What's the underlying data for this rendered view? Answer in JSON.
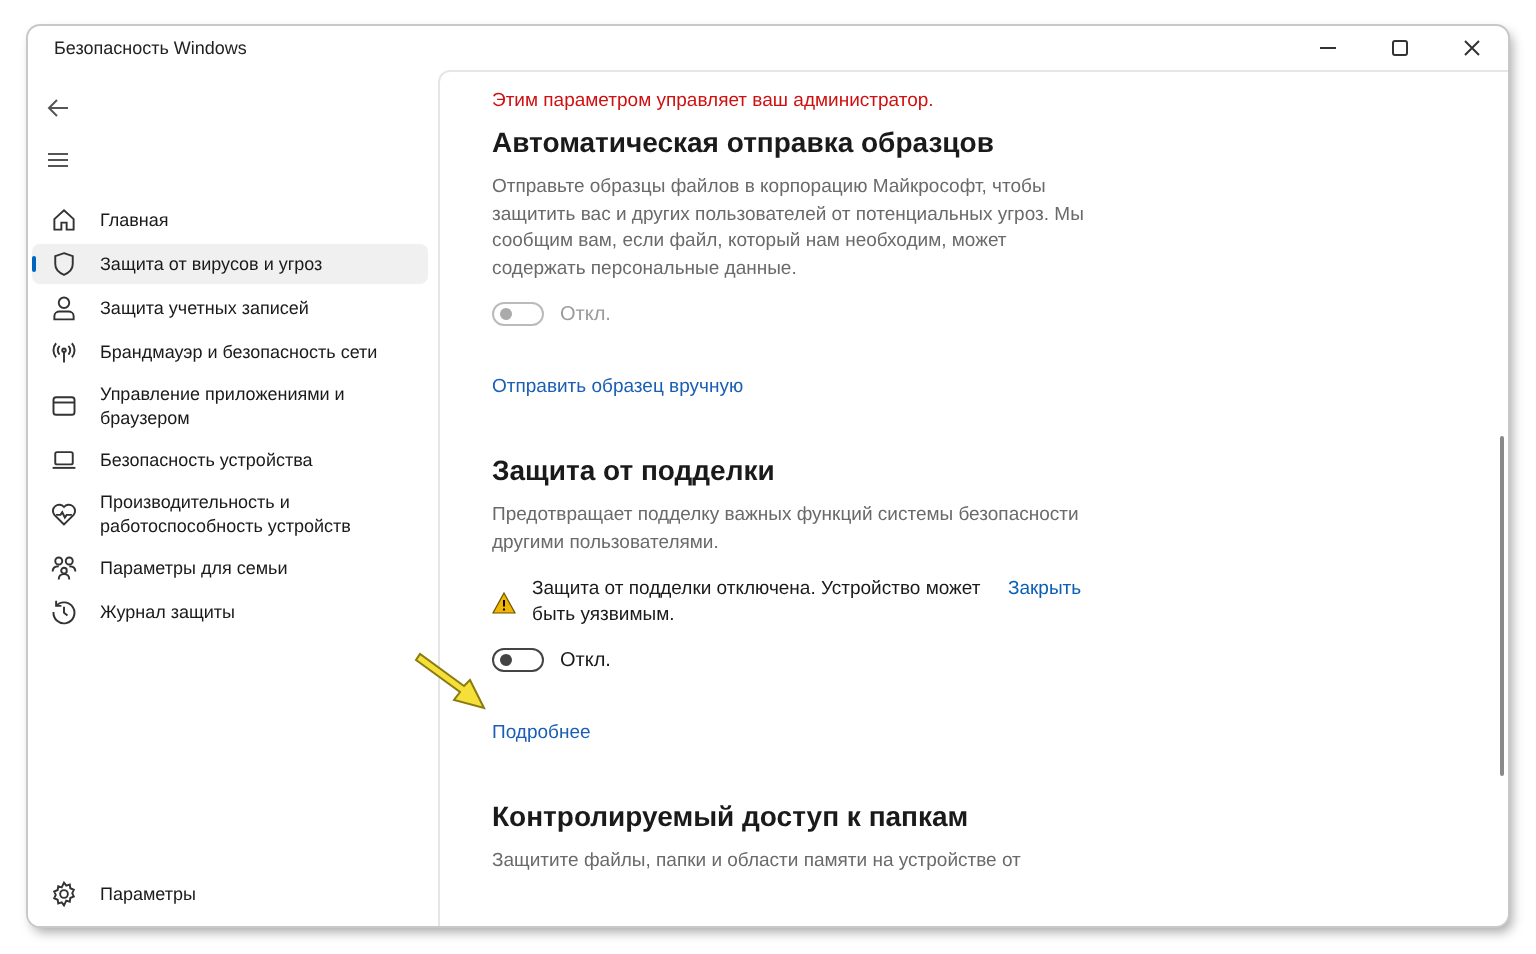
{
  "window": {
    "title": "Безопасность Windows"
  },
  "sidebar": {
    "items": [
      {
        "label": "Главная",
        "selected": false
      },
      {
        "label": "Защита от вирусов и угроз",
        "selected": true
      },
      {
        "label": "Защита учетных записей",
        "selected": false
      },
      {
        "label": "Брандмауэр и безопасность сети",
        "selected": false
      },
      {
        "label": "Управление приложениями и браузером",
        "selected": false
      },
      {
        "label": "Безопасность устройства",
        "selected": false
      },
      {
        "label": "Производительность и работоспособность устройств",
        "selected": false
      },
      {
        "label": "Параметры для семьи",
        "selected": false
      },
      {
        "label": "Журнал защиты",
        "selected": false
      }
    ],
    "footer": {
      "label": "Параметры",
      "selected": false
    }
  },
  "sections": [
    {
      "notice": "Этим параметром управляет ваш администратор.",
      "heading": "Автоматическая отправка образцов",
      "description": "Отправьте образцы файлов в корпорацию Майкрософт, чтобы защитить вас и других пользователей от потенциальных угроз. Мы сообщим вам, если файл, который нам необходим, может содержать персональные данные.",
      "toggle": {
        "on": false,
        "disabled": true,
        "label": "Откл."
      },
      "link": "Отправить образец вручную"
    },
    {
      "heading": "Защита от подделки",
      "description": "Предотвращает подделку важных функций системы безопасности другими пользователями.",
      "warning": {
        "text": "Защита от подделки отключена. Устройство может быть уязвимым.",
        "action": "Закрыть"
      },
      "toggle": {
        "on": false,
        "disabled": false,
        "label": "Откл."
      },
      "link": "Подробнее"
    },
    {
      "heading": "Контролируемый доступ к папкам",
      "description": "Защитите файлы, папки и области памяти на устройстве от"
    }
  ]
}
